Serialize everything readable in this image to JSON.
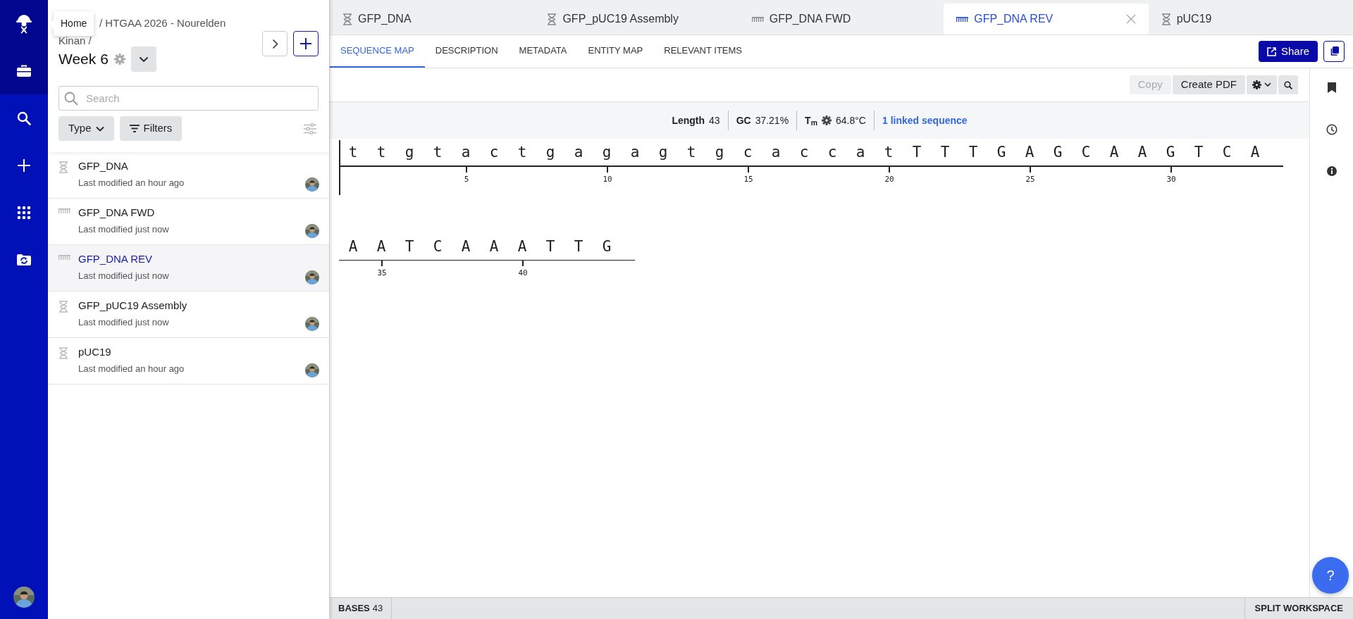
{
  "rail": {
    "items": [
      {
        "kind": "logo",
        "dark": true
      },
      {
        "kind": "briefcase",
        "dark": true
      },
      {
        "kind": "search",
        "dark": false
      },
      {
        "kind": "plus",
        "dark": false
      },
      {
        "kind": "apps",
        "dark": false
      },
      {
        "kind": "folder-sync",
        "dark": false
      }
    ]
  },
  "tooltip": {
    "text": "Home"
  },
  "sidebar": {
    "breadcrumb_lines": [
      "/ HTGAA 2026 - Nourelden",
      "Kinan /"
    ],
    "title": "Week 6",
    "search": {
      "placeholder": "Search"
    },
    "filters": [
      "Type",
      "Filters"
    ],
    "items": [
      {
        "name": "GFP_DNA",
        "kind": "sequence",
        "modified": "Last modified an hour ago",
        "selected": false
      },
      {
        "name": "GFP_DNA FWD",
        "kind": "oligo",
        "modified": "Last modified just now",
        "selected": false
      },
      {
        "name": "GFP_DNA REV",
        "kind": "oligo",
        "modified": "Last modified just now",
        "selected": true
      },
      {
        "name": "GFP_pUC19 Assembly",
        "kind": "sequence",
        "modified": "Last modified just now",
        "selected": false
      },
      {
        "name": "pUC19",
        "kind": "sequence",
        "modified": "Last modified an hour ago",
        "selected": false
      }
    ]
  },
  "tabs": [
    {
      "label": "GFP_DNA",
      "kind": "sequence",
      "selected": false
    },
    {
      "label": "GFP_pUC19 Assembly",
      "kind": "sequence",
      "selected": false
    },
    {
      "label": "GFP_DNA FWD",
      "kind": "oligo",
      "selected": false
    },
    {
      "label": "GFP_DNA REV",
      "kind": "oligo",
      "selected": true
    },
    {
      "label": "pUC19",
      "kind": "sequence",
      "selected": false
    }
  ],
  "subtabs": [
    {
      "label": "SEQUENCE MAP",
      "selected": true
    },
    {
      "label": "DESCRIPTION",
      "selected": false
    },
    {
      "label": "METADATA",
      "selected": false
    },
    {
      "label": "ENTITY MAP",
      "selected": false
    },
    {
      "label": "RELEVANT ITEMS",
      "selected": false
    }
  ],
  "share": "Share",
  "toolbar": [
    {
      "label": "Copy",
      "disabled": true
    },
    {
      "label": "Create PDF",
      "disabled": false
    }
  ],
  "stats": {
    "length_label": "Length",
    "length": "43",
    "gc_label": "GC",
    "gc": "37.21%",
    "tm_label": "T$_{m}$",
    "tm": "64.8°C",
    "linked": "1 linked sequence"
  },
  "sequence": {
    "rows": [
      {
        "bases": "t t g t a c t g a g a g t g c a c c a t T T T G A G C A A G T C A",
        "ticks": [
          "5",
          "10",
          "15",
          "20",
          "25",
          "30"
        ],
        "cursor": true
      },
      {
        "bases": "A A T C A A A T T G",
        "ticks": [
          "35",
          "40"
        ],
        "cursor": false
      }
    ]
  },
  "status": {
    "bases_label": "BASES",
    "bases": "43",
    "split": "SPLIT WORKSPACE"
  },
  "help": "?"
}
